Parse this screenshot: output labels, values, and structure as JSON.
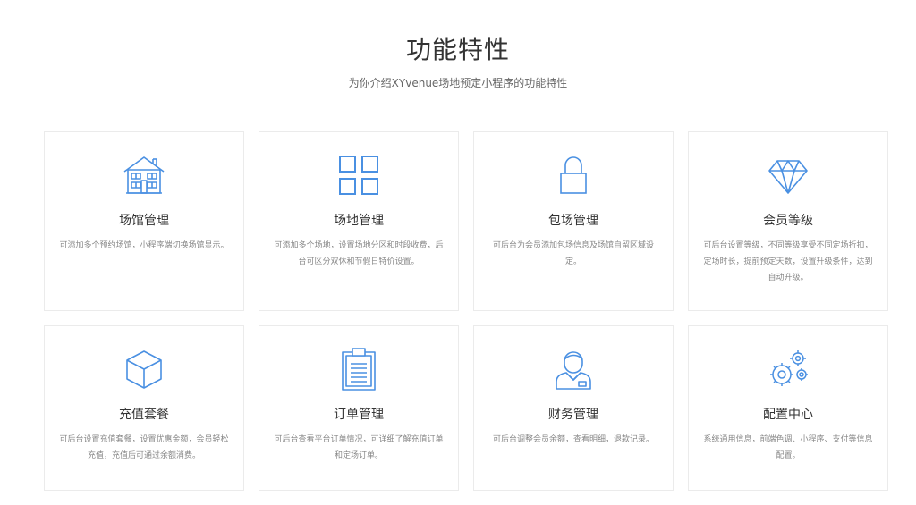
{
  "header": {
    "title": "功能特性",
    "subtitle": "为你介绍XYvenue场地预定小程序的功能特性"
  },
  "theme": {
    "accent": "#4a90e2",
    "border": "#ebebeb"
  },
  "features": [
    {
      "icon": "building-icon",
      "title": "场馆管理",
      "desc": "可添加多个预约场馆，小程序端切换场馆显示。"
    },
    {
      "icon": "grid-icon",
      "title": "场地管理",
      "desc": "可添加多个场地，设置场地分区和时段收费，后台可区分双休和节假日特价设置。"
    },
    {
      "icon": "lock-icon",
      "title": "包场管理",
      "desc": "可后台为会员添加包场信息及场馆自留区域设定。"
    },
    {
      "icon": "diamond-icon",
      "title": "会员等级",
      "desc": "可后台设置等级，不同等级享受不同定场折扣，定场时长，提前预定天数，设置升级条件，达到自动升级。"
    },
    {
      "icon": "cube-icon",
      "title": "充值套餐",
      "desc": "可后台设置充值套餐，设置优惠金额，会员轻松充值，充值后可通过余额消费。"
    },
    {
      "icon": "clipboard-icon",
      "title": "订单管理",
      "desc": "可后台查看平台订单情况，可详细了解充值订单和定场订单。"
    },
    {
      "icon": "staff-icon",
      "title": "财务管理",
      "desc": "可后台调整会员余额，查看明细，退款记录。"
    },
    {
      "icon": "gears-icon",
      "title": "配置中心",
      "desc": "系统通用信息，前端色调、小程序、支付等信息配置。"
    }
  ]
}
